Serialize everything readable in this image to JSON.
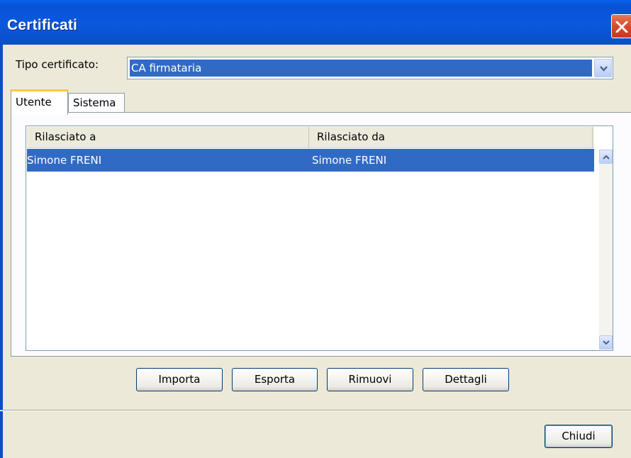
{
  "window": {
    "title": "Certificati"
  },
  "tipo": {
    "label": "Tipo certificato:",
    "value": "CA firmataria"
  },
  "tabs": [
    {
      "label": "Utente",
      "active": true
    },
    {
      "label": "Sistema",
      "active": false
    }
  ],
  "table": {
    "columns": [
      "Rilasciato a",
      "Rilasciato da"
    ],
    "rows": [
      {
        "issued_to": "Simone FRENI",
        "issued_by": "Simone FRENI",
        "selected": true
      }
    ]
  },
  "buttons": {
    "importa": "Importa",
    "esporta": "Esporta",
    "rimuovi": "Rimuovi",
    "dettagli": "Dettagli",
    "chiudi": "Chiudi"
  },
  "icons": {
    "close": "close-icon",
    "combo_arrow": "chevron-down-icon",
    "scroll_up": "chevron-up-icon",
    "scroll_down": "chevron-down-icon"
  },
  "colors": {
    "titlebar": "#0a58de",
    "selection": "#316ac5",
    "close_button": "#d84a2b",
    "active_tab_accent": "#ffc83c"
  }
}
